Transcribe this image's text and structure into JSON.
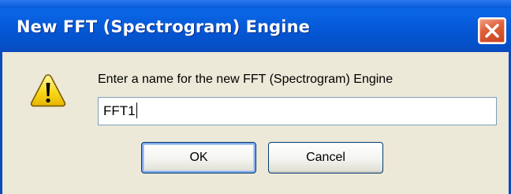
{
  "window": {
    "title": "New FFT (Spectrogram) Engine"
  },
  "dialog": {
    "prompt": "Enter a name for the new FFT (Spectrogram) Engine",
    "input_value": "FFT1",
    "ok_label": "OK",
    "cancel_label": "Cancel"
  },
  "icons": {
    "close": "close-icon",
    "warning": "warning-icon"
  },
  "colors": {
    "titlebar": "#0558d6",
    "close_button": "#e0603c",
    "dialog_background": "#ece9d8",
    "warning_yellow": "#f8d81c"
  }
}
